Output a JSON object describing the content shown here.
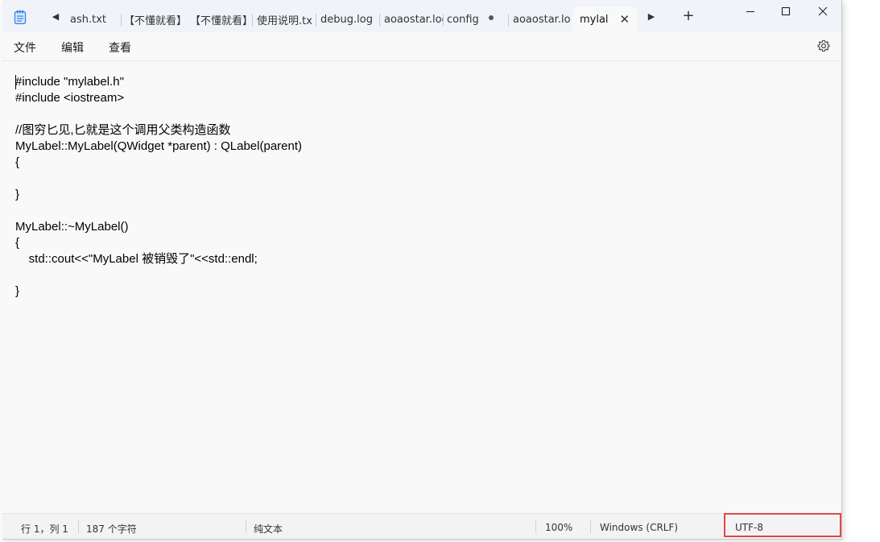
{
  "tabs": [
    {
      "label": "ash.txt"
    },
    {
      "label": "【不懂就看】"
    },
    {
      "label": "【不懂就看】"
    },
    {
      "label": "使用说明.tx"
    },
    {
      "label": "debug.log"
    },
    {
      "label": "aoaostar.log"
    },
    {
      "label": "config"
    },
    {
      "label": "aoaostar.log"
    },
    {
      "label": "mylal"
    }
  ],
  "menu": {
    "file": "文件",
    "edit": "编辑",
    "view": "查看"
  },
  "editor": {
    "content": "#include \"mylabel.h\"\n#include <iostream>\n\n//图穷匕见,匕就是这个调用父类构造函数\nMyLabel::MyLabel(QWidget *parent) : QLabel(parent)\n{\n\n}\n\nMyLabel::~MyLabel()\n{\n    std::cout<<\"MyLabel 被销毁了\"<<std::endl;\n\n}"
  },
  "status": {
    "position": "行 1，列 1",
    "char_count": "187 个字符",
    "format": "纯文本",
    "zoom": "100%",
    "line_ending": "Windows (CRLF)",
    "encoding": "UTF-8"
  },
  "colors": {
    "highlight": "#e0474c",
    "app_icon": "#2b7de9"
  }
}
